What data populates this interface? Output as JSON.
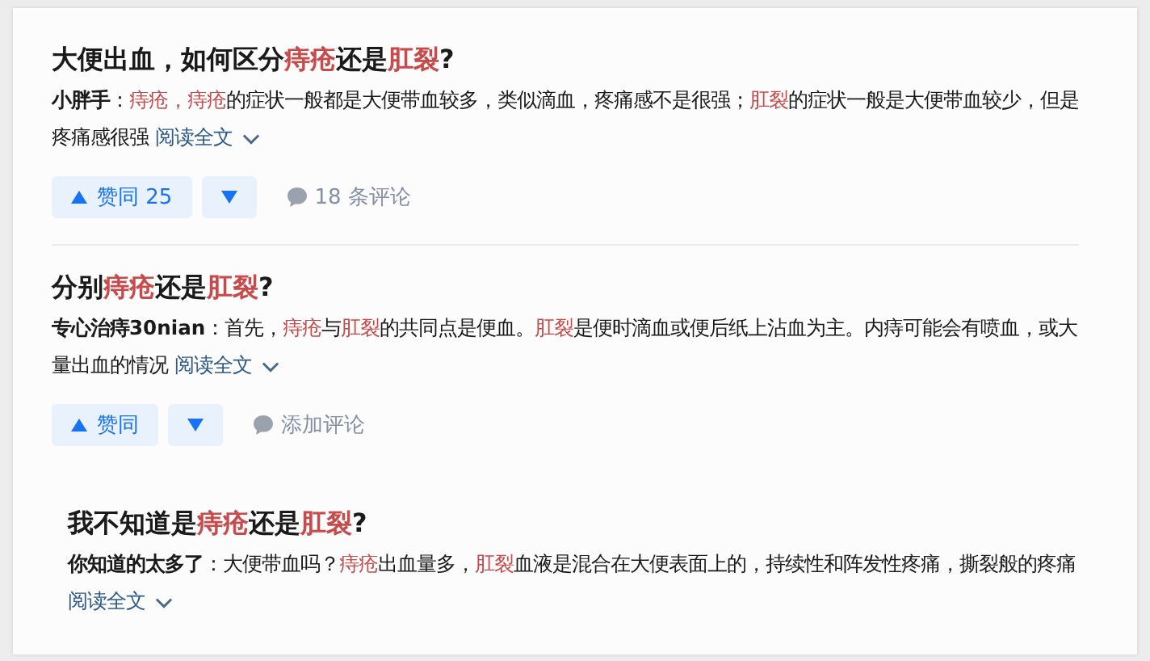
{
  "answers": [
    {
      "title": [
        {
          "text": "大便出血，如何区分",
          "highlight": false
        },
        {
          "text": "痔疮",
          "highlight": true
        },
        {
          "text": "还是",
          "highlight": false
        },
        {
          "text": "肛裂",
          "highlight": true
        },
        {
          "text": "?",
          "highlight": false
        }
      ],
      "author": "小胖手",
      "excerpt": [
        {
          "text": "：",
          "highlight": false
        },
        {
          "text": "痔疮，痔疮",
          "highlight": true
        },
        {
          "text": "的症状一般都是大便带血较多，类似滴血，疼痛感不是很强；",
          "highlight": false
        },
        {
          "text": "肛裂",
          "highlight": true
        },
        {
          "text": "的症状一般是大便带血较少，但是疼痛感很强",
          "highlight": false
        }
      ],
      "read_more": "阅读全文",
      "actions": {
        "vote": "赞同 25",
        "comments": "18 条评论"
      }
    },
    {
      "title": [
        {
          "text": "分别",
          "highlight": false
        },
        {
          "text": "痔疮",
          "highlight": true
        },
        {
          "text": "还是",
          "highlight": false
        },
        {
          "text": "肛裂",
          "highlight": true
        },
        {
          "text": "?",
          "highlight": false
        }
      ],
      "author": "专心治痔30nian",
      "excerpt": [
        {
          "text": "：首先，",
          "highlight": false
        },
        {
          "text": "痔疮",
          "highlight": true
        },
        {
          "text": "与",
          "highlight": false
        },
        {
          "text": "肛裂",
          "highlight": true
        },
        {
          "text": "的共同点是便血。",
          "highlight": false
        },
        {
          "text": "肛裂",
          "highlight": true
        },
        {
          "text": "是便时滴血或便后纸上沾血为主。内痔可能会有喷血，或大量出血的情况",
          "highlight": false
        }
      ],
      "read_more": "阅读全文",
      "actions": {
        "vote": "赞同",
        "comments": "添加评论"
      }
    },
    {
      "title": [
        {
          "text": "我不知道是",
          "highlight": false
        },
        {
          "text": "痔疮",
          "highlight": true
        },
        {
          "text": "还是",
          "highlight": false
        },
        {
          "text": "肛裂",
          "highlight": true
        },
        {
          "text": "?",
          "highlight": false
        }
      ],
      "author": "你知道的太多了",
      "excerpt": [
        {
          "text": "：大便带血吗？",
          "highlight": false
        },
        {
          "text": "痔疮",
          "highlight": true
        },
        {
          "text": "出血量多，",
          "highlight": false
        },
        {
          "text": "肛裂",
          "highlight": true
        },
        {
          "text": "血液是混合在大便表面上的，持续性和阵发性疼痛，撕裂般的疼痛",
          "highlight": false
        }
      ],
      "read_more": "阅读全文"
    }
  ]
}
